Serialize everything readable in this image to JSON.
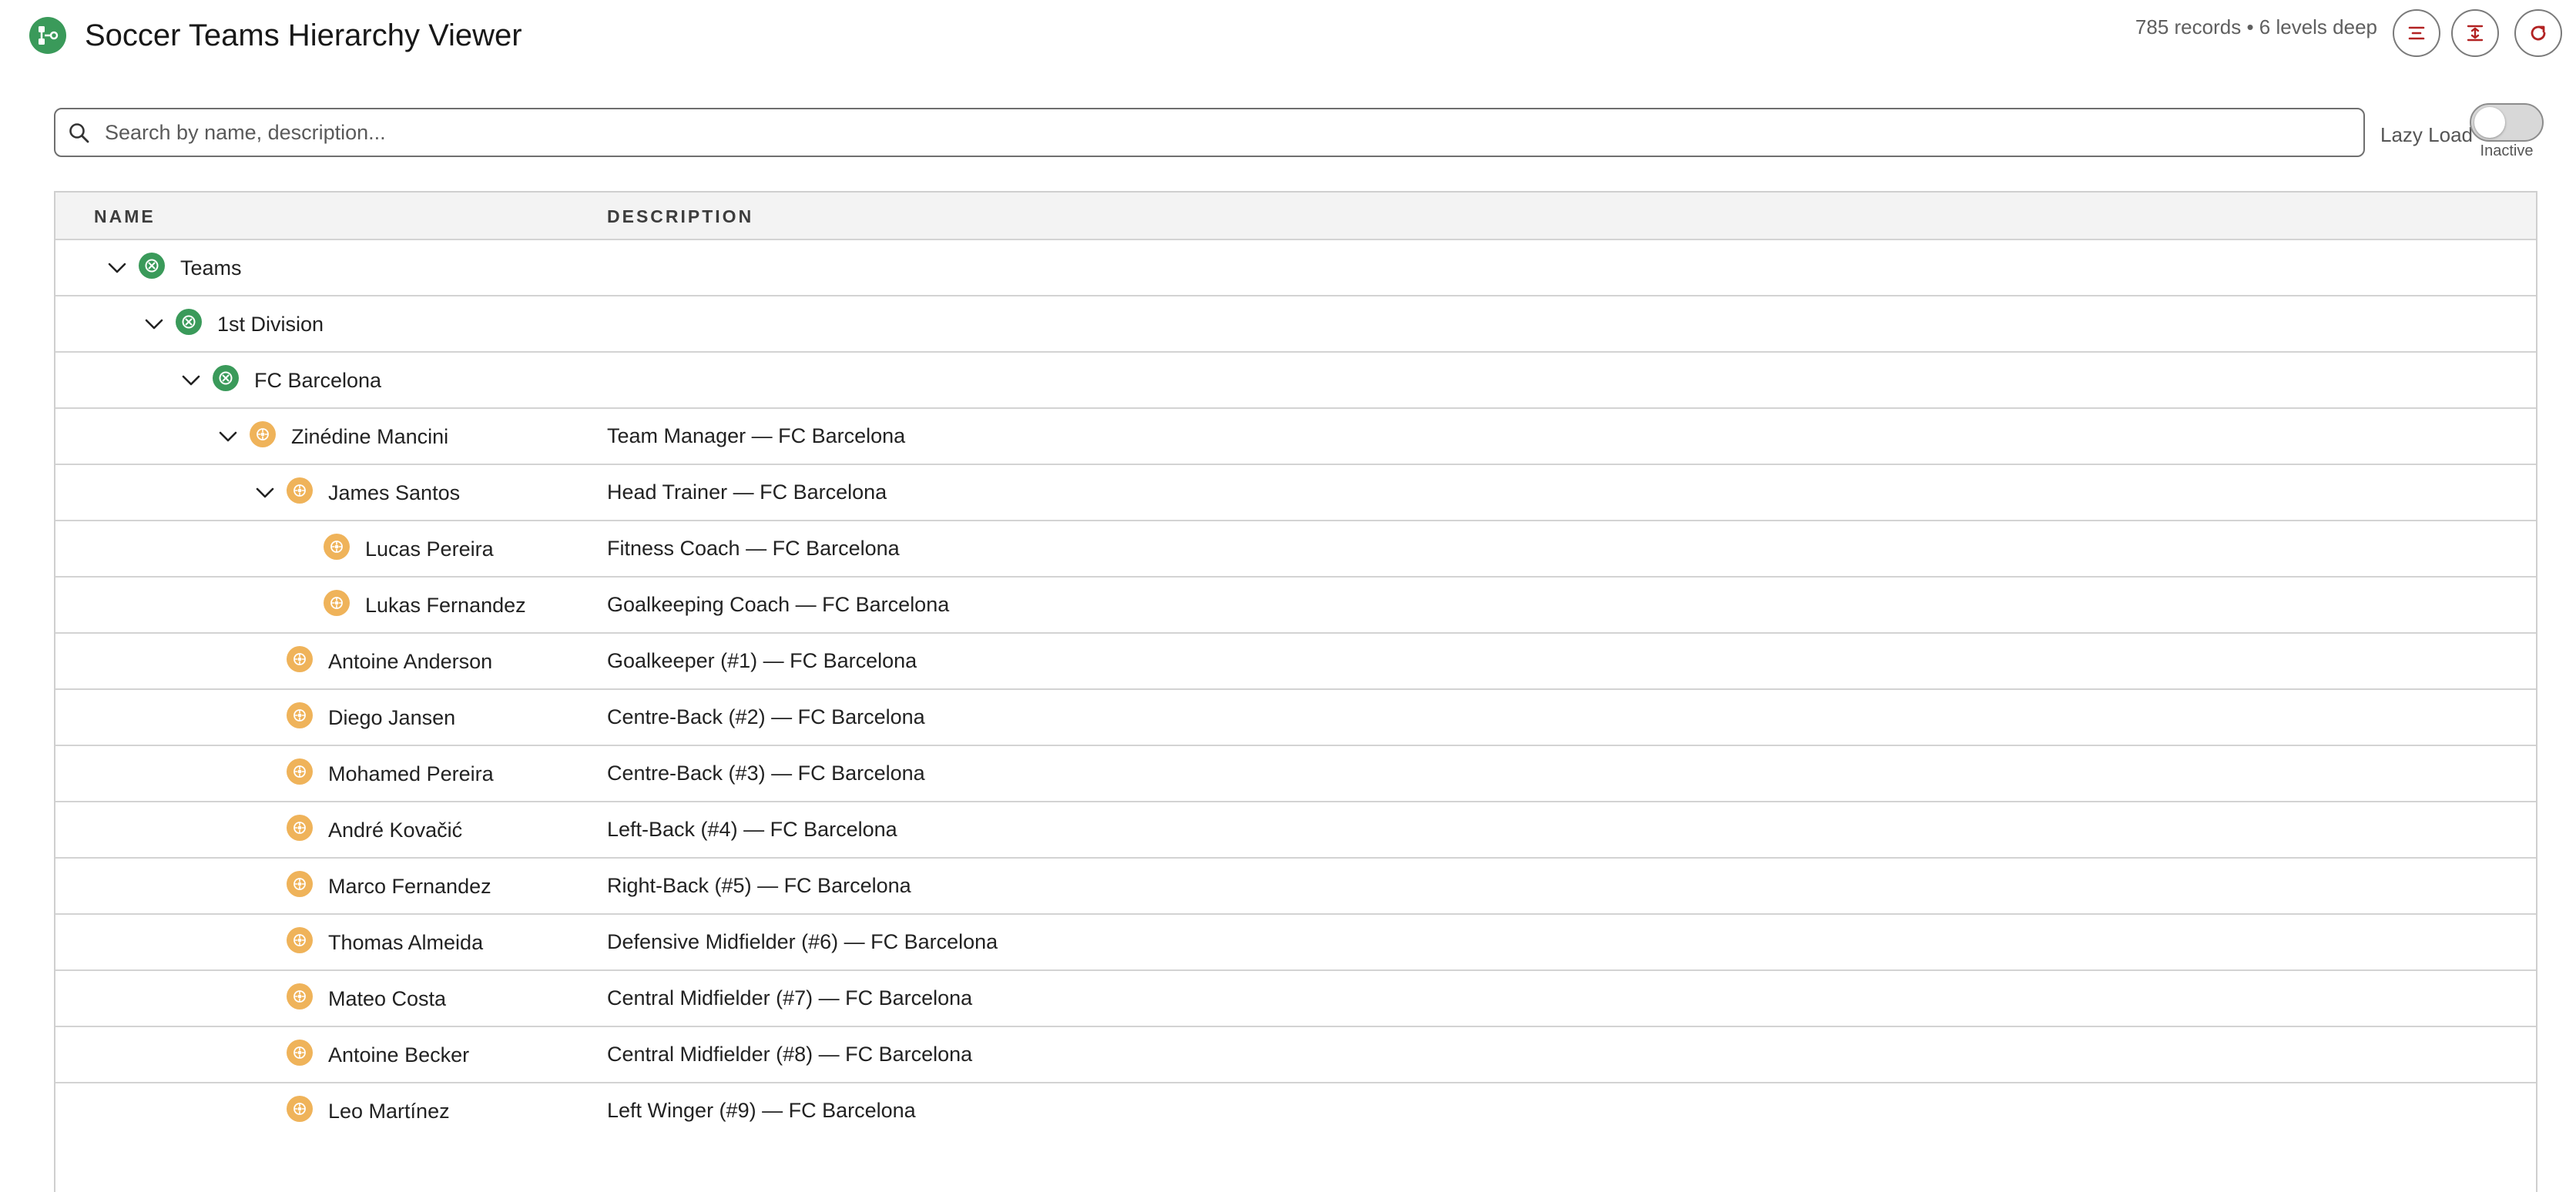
{
  "header": {
    "title": "Soccer Teams Hierarchy Viewer",
    "stats": "785 records • 6 levels deep",
    "buttons": [
      {
        "name": "collapse-all-button",
        "icon": "collapse-icon"
      },
      {
        "name": "expand-all-button",
        "icon": "expand-icon"
      },
      {
        "name": "refresh-button",
        "icon": "refresh-icon"
      }
    ]
  },
  "search": {
    "placeholder": "Search by name, description...",
    "value": ""
  },
  "lazy_load": {
    "label": "Lazy Load",
    "state": "Inactive",
    "enabled": false
  },
  "colors": {
    "accent": "#3a9a5a",
    "person": "#efb35a",
    "title": "#181818",
    "border": "#d3d3d3"
  },
  "table": {
    "columns": [
      "NAME",
      "DESCRIPTION"
    ],
    "rows": [
      {
        "name": "Teams",
        "description": "",
        "level": 0,
        "type": "group",
        "expanded": true
      },
      {
        "name": "1st Division",
        "description": "",
        "level": 1,
        "type": "group",
        "expanded": true
      },
      {
        "name": "FC Barcelona",
        "description": "",
        "level": 2,
        "type": "group",
        "expanded": true
      },
      {
        "name": "Zinédine Mancini",
        "description": "Team Manager — FC Barcelona",
        "level": 3,
        "type": "person",
        "expanded": true
      },
      {
        "name": "James Santos",
        "description": "Head Trainer — FC Barcelona",
        "level": 4,
        "type": "person",
        "expanded": true
      },
      {
        "name": "Lucas Pereira",
        "description": "Fitness Coach — FC Barcelona",
        "level": 5,
        "type": "person",
        "expanded": null
      },
      {
        "name": "Lukas Fernandez",
        "description": "Goalkeeping Coach — FC Barcelona",
        "level": 5,
        "type": "person",
        "expanded": null
      },
      {
        "name": "Antoine Anderson",
        "description": "Goalkeeper (#1) — FC Barcelona",
        "level": 4,
        "type": "person",
        "expanded": null
      },
      {
        "name": "Diego Jansen",
        "description": "Centre-Back (#2) — FC Barcelona",
        "level": 4,
        "type": "person",
        "expanded": null
      },
      {
        "name": "Mohamed Pereira",
        "description": "Centre-Back (#3) — FC Barcelona",
        "level": 4,
        "type": "person",
        "expanded": null
      },
      {
        "name": "André Kovačić",
        "description": "Left-Back (#4) — FC Barcelona",
        "level": 4,
        "type": "person",
        "expanded": null
      },
      {
        "name": "Marco Fernandez",
        "description": "Right-Back (#5) — FC Barcelona",
        "level": 4,
        "type": "person",
        "expanded": null
      },
      {
        "name": "Thomas Almeida",
        "description": "Defensive Midfielder (#6) — FC Barcelona",
        "level": 4,
        "type": "person",
        "expanded": null
      },
      {
        "name": "Mateo Costa",
        "description": "Central Midfielder (#7) — FC Barcelona",
        "level": 4,
        "type": "person",
        "expanded": null
      },
      {
        "name": "Antoine Becker",
        "description": "Central Midfielder (#8) — FC Barcelona",
        "level": 4,
        "type": "person",
        "expanded": null
      },
      {
        "name": "Leo Martínez",
        "description": "Left Winger (#9) — FC Barcelona",
        "level": 4,
        "type": "person",
        "expanded": null
      }
    ]
  }
}
